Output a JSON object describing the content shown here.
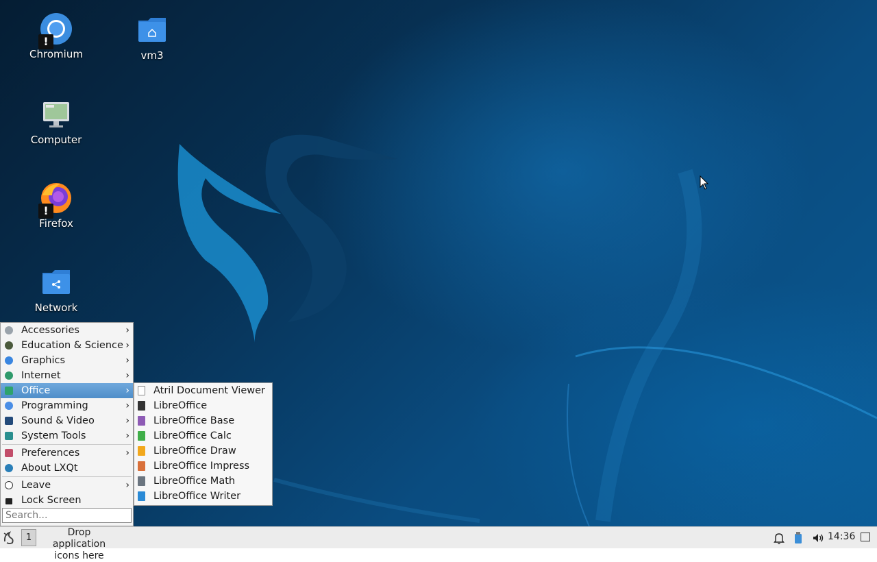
{
  "desktop": {
    "icons": [
      {
        "label": "Chromium",
        "icon": "chromium-icon",
        "warning": "!"
      },
      {
        "label": "vm3",
        "icon": "home-folder-icon"
      },
      {
        "label": "Computer",
        "icon": "computer-icon"
      },
      {
        "label": "Firefox",
        "icon": "firefox-icon",
        "warning": "!"
      },
      {
        "label": "Network",
        "icon": "network-folder-icon"
      }
    ]
  },
  "app_menu": {
    "items": [
      {
        "label": "Accessories",
        "icon": "accessories-icon",
        "submenu": true
      },
      {
        "label": "Education & Science",
        "icon": "education-icon",
        "submenu": true
      },
      {
        "label": "Graphics",
        "icon": "graphics-icon",
        "submenu": true
      },
      {
        "label": "Internet",
        "icon": "internet-icon",
        "submenu": true
      },
      {
        "label": "Office",
        "icon": "office-icon",
        "submenu": true,
        "active": true
      },
      {
        "label": "Programming",
        "icon": "programming-icon",
        "submenu": true
      },
      {
        "label": "Sound & Video",
        "icon": "sound-video-icon",
        "submenu": true
      },
      {
        "label": "System Tools",
        "icon": "system-tools-icon",
        "submenu": true
      },
      {
        "label": "Preferences",
        "icon": "preferences-icon",
        "submenu": true
      },
      {
        "label": "About LXQt",
        "icon": "lxqt-icon",
        "submenu": false
      },
      {
        "label": "Leave",
        "icon": "power-icon",
        "submenu": true
      },
      {
        "label": "Lock Screen",
        "icon": "lock-icon",
        "submenu": false
      }
    ],
    "arrow": "›",
    "search_placeholder": "Search..."
  },
  "office_submenu": {
    "items": [
      {
        "label": "Atril Document Viewer",
        "icon": "atril-icon"
      },
      {
        "label": "LibreOffice",
        "icon": "libreoffice-icon"
      },
      {
        "label": "LibreOffice Base",
        "icon": "libreoffice-base-icon"
      },
      {
        "label": "LibreOffice Calc",
        "icon": "libreoffice-calc-icon"
      },
      {
        "label": "LibreOffice Draw",
        "icon": "libreoffice-draw-icon"
      },
      {
        "label": "LibreOffice Impress",
        "icon": "libreoffice-impress-icon"
      },
      {
        "label": "LibreOffice Math",
        "icon": "libreoffice-math-icon"
      },
      {
        "label": "LibreOffice Writer",
        "icon": "libreoffice-writer-icon"
      }
    ]
  },
  "taskbar": {
    "desktop_number": "1",
    "quicklaunch_line1": "Drop application",
    "quicklaunch_line2": "icons here",
    "clock": "14:36"
  },
  "colors": {
    "menu_highlight": "#5b9bd5",
    "taskbar": "#ececec",
    "desktop_dark": "#062540",
    "desktop_light": "#0b5b95"
  }
}
